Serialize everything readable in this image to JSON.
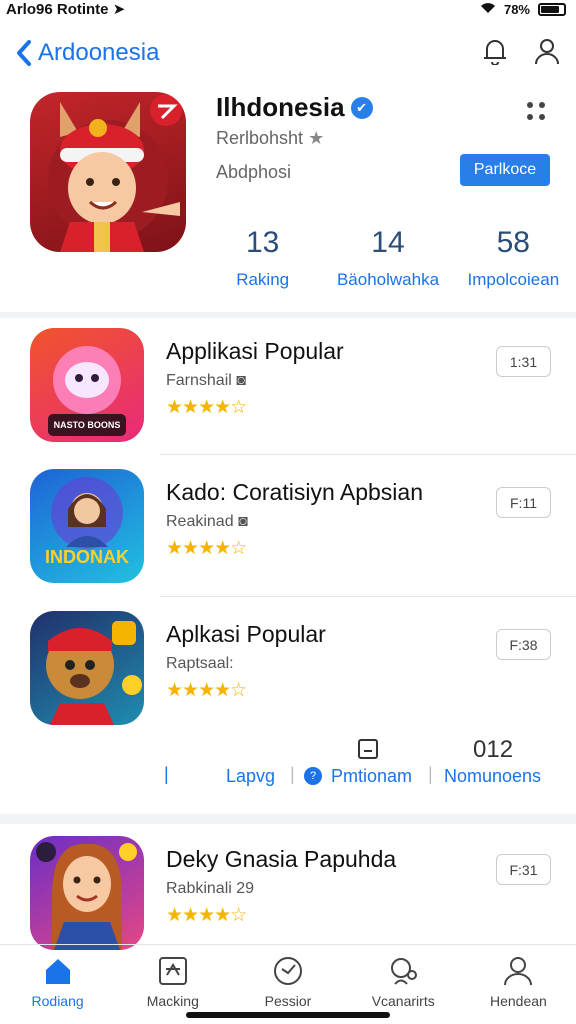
{
  "status_bar": {
    "left": "Arlo96",
    "carrier": "Rotinte",
    "battery": "78%"
  },
  "nav": {
    "back_label": "Ardoonesia"
  },
  "hero": {
    "title": "Ilhdonesia",
    "subtitle": "Rerlbohsht",
    "subtitle2": "Abdphosi",
    "button": "Parlkoce",
    "stats": [
      {
        "value": "13",
        "label": "Raking"
      },
      {
        "value": "14",
        "label": "Bäoholwahka"
      },
      {
        "value": "58",
        "label": "Impolcoiean"
      }
    ]
  },
  "apps": [
    {
      "name": "Applikasi Popular",
      "meta": "Farnshail",
      "stars": "★★★★☆",
      "button": "1:31",
      "icon_colors": [
        "#f0552b",
        "#e82a7a"
      ],
      "icon_caption": "NASTO BOONS"
    },
    {
      "name": "Kado: Coratisiyn Apbsian",
      "meta": "Reakinad",
      "stars": "★★★★☆",
      "button": "F:11",
      "icon_colors": [
        "#1e63d6",
        "#21c1e0"
      ],
      "icon_caption": "INDONAK"
    },
    {
      "name": "Aplkasi Popular",
      "meta": "Raptsaal:",
      "stars": "★★★★☆",
      "button": "F:38",
      "icon_colors": [
        "#21306b",
        "#1f8db0"
      ],
      "icon_caption": ""
    },
    {
      "name": "Deky Gnasia Papuhda",
      "meta": "Rabkinali 29",
      "stars": "★★★★☆",
      "button": "F:31",
      "icon_colors": [
        "#6b2ec7",
        "#e64785"
      ],
      "icon_caption": ""
    }
  ],
  "action_bar": {
    "lang": "Lapvg",
    "middle": "Pmtionam",
    "count": "012",
    "right": "Nomunoens"
  },
  "tabs": [
    {
      "label": "Rodiang",
      "icon": "home-icon",
      "active": true
    },
    {
      "label": "Macking",
      "icon": "chart-icon",
      "active": false
    },
    {
      "label": "Pessior",
      "icon": "chat-icon",
      "active": false
    },
    {
      "label": "Vcanarirts",
      "icon": "people-icon",
      "active": false
    },
    {
      "label": "Hendean",
      "icon": "user-icon",
      "active": false
    }
  ]
}
